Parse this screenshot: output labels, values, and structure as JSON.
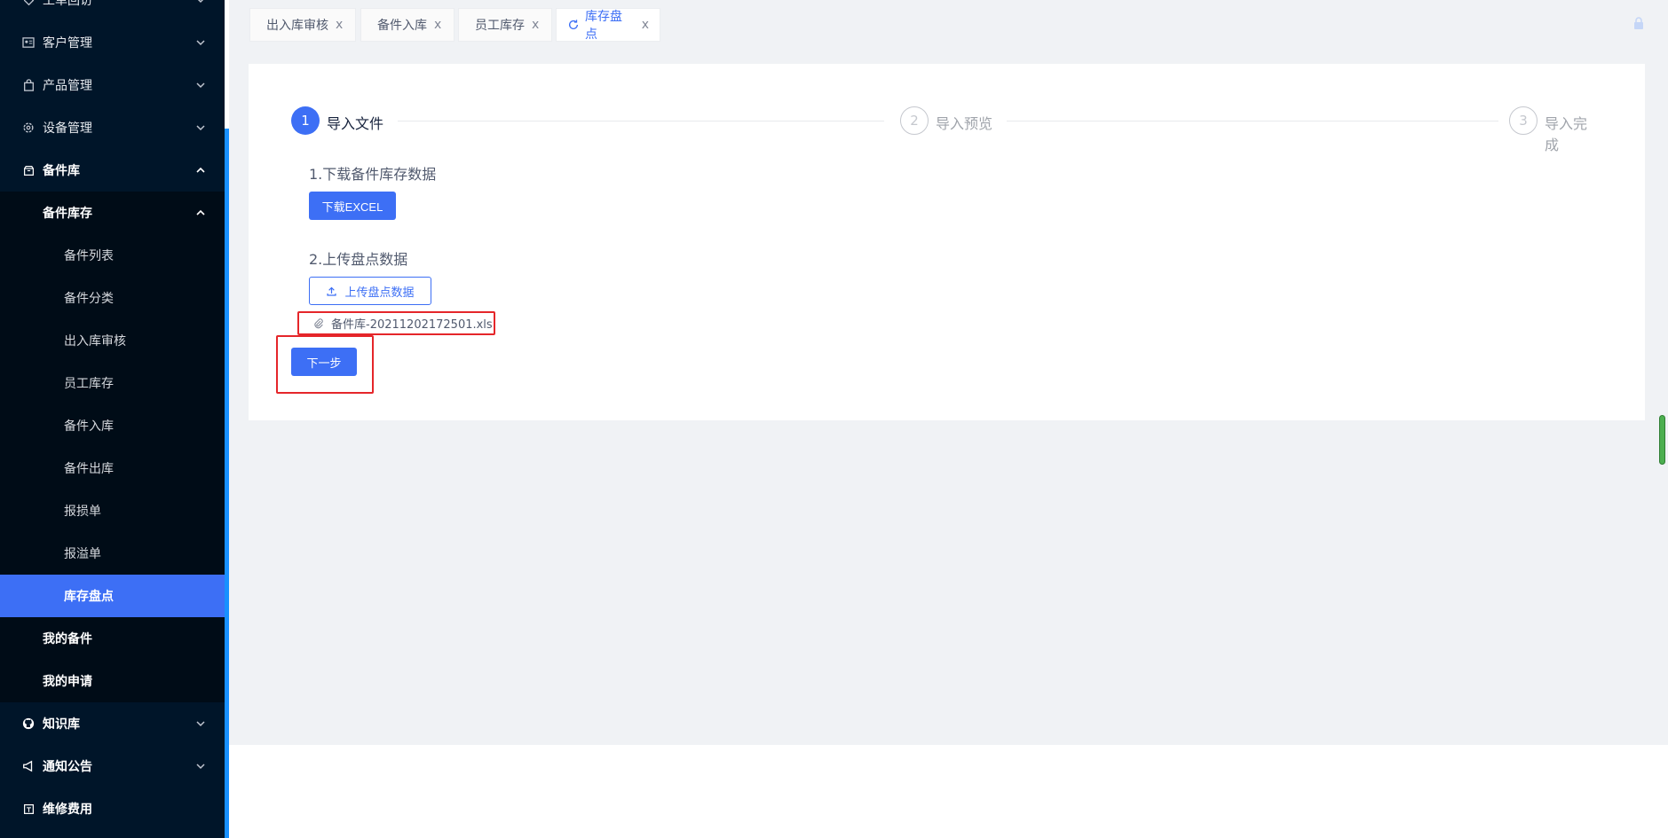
{
  "sidebar": {
    "top_partial": "工单回访",
    "items": [
      {
        "label": "客户管理",
        "icon": "id-card-icon"
      },
      {
        "label": "产品管理",
        "icon": "bag-icon"
      },
      {
        "label": "设备管理",
        "icon": "gear-icon"
      },
      {
        "label": "备件库",
        "icon": "box-icon"
      }
    ],
    "sub_group": "备件库存",
    "sub_items": [
      "备件列表",
      "备件分类",
      "出入库审核",
      "员工库存",
      "备件入库",
      "备件出库",
      "报损单",
      "报溢单",
      "库存盘点"
    ],
    "sub_active": "库存盘点",
    "extra_items": [
      "我的备件",
      "我的申请"
    ],
    "bottom_items": [
      {
        "label": "知识库",
        "icon": "github-icon"
      },
      {
        "label": "通知公告",
        "icon": "megaphone-icon"
      },
      {
        "label": "维修费用",
        "icon": "receipt-icon"
      }
    ]
  },
  "tabs": [
    {
      "label": "出入库审核",
      "close": "x"
    },
    {
      "label": "备件入库",
      "close": "x"
    },
    {
      "label": "员工库存",
      "close": "x"
    },
    {
      "label": "库存盘点",
      "close": "x",
      "active": true
    }
  ],
  "steps": [
    {
      "num": "1",
      "title": "导入文件",
      "status": "done"
    },
    {
      "num": "2",
      "title": "导入预览",
      "status": "wait"
    },
    {
      "num": "3",
      "title": "导入完成",
      "status": "wait"
    }
  ],
  "section1": {
    "label": "1.下载备件库存数据",
    "button": "下载EXCEL"
  },
  "section2": {
    "label": "2.上传盘点数据",
    "button": "上传盘点数据"
  },
  "uploaded_file": "备件库-20211202172501.xls",
  "next_button": "下一步",
  "colors": {
    "primary": "#3d6ff5",
    "sidebar": "#001529",
    "highlight": "#e5262a"
  }
}
